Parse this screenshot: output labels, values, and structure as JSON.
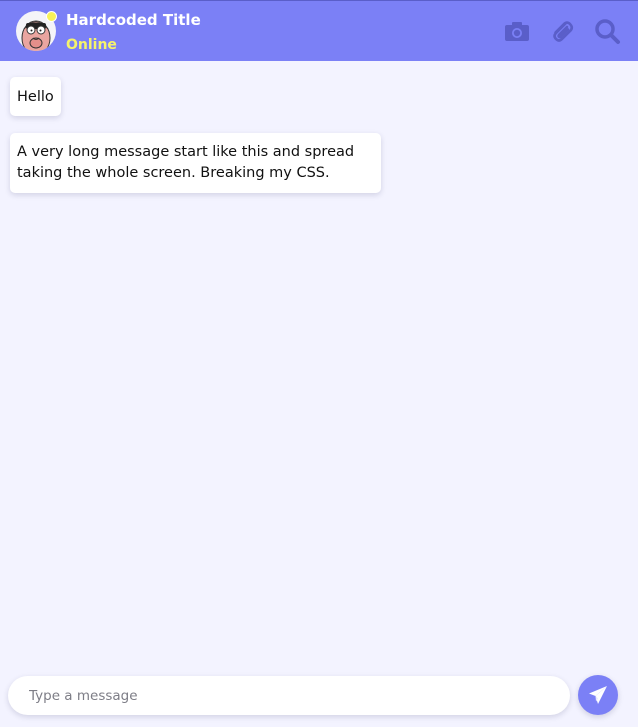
{
  "header": {
    "title": "Hardcoded Title",
    "status": "Online",
    "icons": [
      "avatar",
      "camera-icon",
      "paperclip-icon",
      "search-icon"
    ]
  },
  "messages": [
    {
      "text": "Hello"
    },
    {
      "text": "A very long message start like this and spread taking the whole screen. Breaking my CSS."
    }
  ],
  "composer": {
    "placeholder": "Type a message",
    "send_icon": "send-icon"
  },
  "colors": {
    "accent": "#7b80f6",
    "status": "#f5f36c",
    "background": "#f3f3ff",
    "header_icon": "#5a5ec9"
  }
}
